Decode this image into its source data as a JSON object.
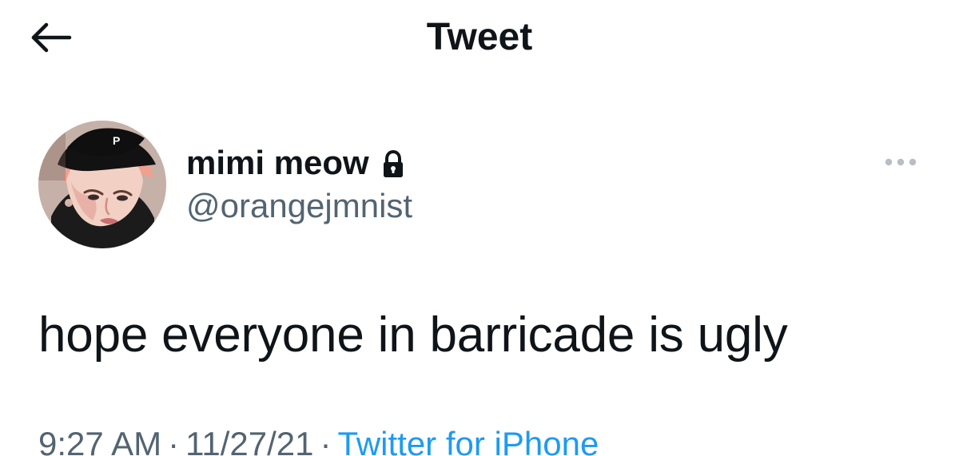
{
  "header": {
    "title": "Tweet",
    "back_icon": "arrow-left-icon"
  },
  "tweet": {
    "author": {
      "display_name": "mimi meow",
      "username": "@orangejmnist",
      "protected_icon": "lock-icon",
      "avatar_icon": "profile-photo"
    },
    "more_icon": "more-horizontal-icon",
    "text": "hope everyone in barricade is ugly",
    "meta": {
      "time": "9:27 AM",
      "separator_1": "·",
      "date": "11/27/21",
      "separator_2": "·",
      "source": "Twitter for iPhone"
    }
  },
  "colors": {
    "text_primary": "#0f1419",
    "text_secondary": "#536471",
    "link": "#1d9bf0",
    "background": "#ffffff"
  }
}
